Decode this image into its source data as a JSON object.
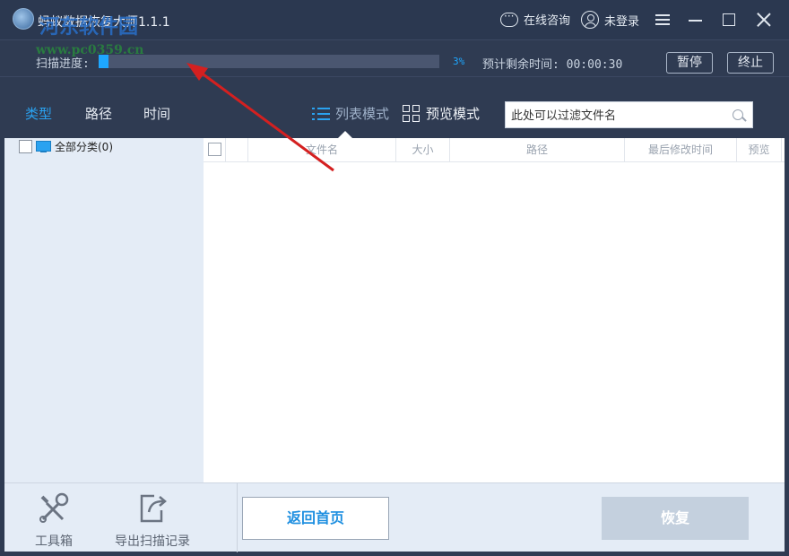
{
  "window": {
    "title": "蚂蚁数据恢复大师1.1.1",
    "online_consult": "在线咨询",
    "login_status": "未登录"
  },
  "watermark": {
    "name": "河东软件园",
    "url": "www.pc0359.cn"
  },
  "scan": {
    "label": "扫描进度:",
    "progress_percent": 3,
    "percent_text": "3%",
    "remaining": "预计剩余时间: 00:00:30",
    "pause_label": "暂停",
    "stop_label": "终止"
  },
  "tabs": [
    {
      "label": "类型",
      "active": true
    },
    {
      "label": "路径",
      "active": false
    },
    {
      "label": "时间",
      "active": false
    }
  ],
  "view_modes": {
    "list_label": "列表模式",
    "preview_label": "预览模式"
  },
  "search": {
    "placeholder": "此处可以过滤文件名"
  },
  "tree": {
    "items": [
      {
        "label": "全部分类(0)",
        "icon": "monitor-icon"
      }
    ]
  },
  "table": {
    "columns": [
      "文件名",
      "大小",
      "路径",
      "最后修改时间",
      "预览"
    ],
    "rows": []
  },
  "bottom": {
    "toolbox_label": "工具箱",
    "export_label": "导出扫描记录",
    "home_label": "返回首页",
    "recover_label": "恢复"
  },
  "colors": {
    "accent": "#1ea7ff",
    "titlebar": "#2b3850",
    "panel": "#e4ecf6",
    "annotation_arrow": "#d42020"
  }
}
